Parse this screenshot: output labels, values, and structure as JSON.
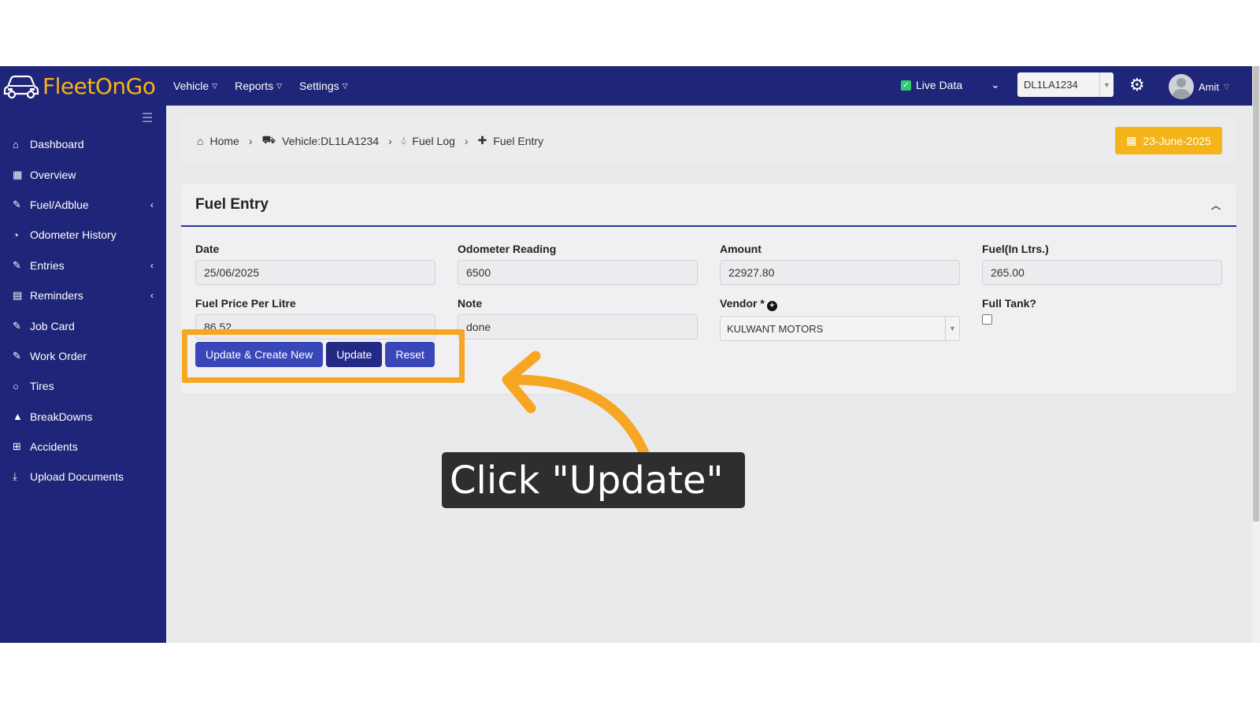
{
  "app": {
    "logo_text": "FleetOnGo",
    "nav": [
      {
        "label": "Vehicle"
      },
      {
        "label": "Reports"
      },
      {
        "label": "Settings"
      }
    ],
    "live_data_label": "Live Data",
    "vehicle_select": "DL1LA1234",
    "user_name": "Amit"
  },
  "sidebar": {
    "items": [
      {
        "label": "Dashboard",
        "icon": "home-icon"
      },
      {
        "label": "Overview",
        "icon": "grid-icon"
      },
      {
        "label": "Fuel/Adblue",
        "icon": "edit-icon",
        "has_children": true
      },
      {
        "label": "Odometer History",
        "icon": "gauge-icon"
      },
      {
        "label": "Entries",
        "icon": "edit-icon",
        "has_children": true
      },
      {
        "label": "Reminders",
        "icon": "calendar-icon",
        "has_children": true
      },
      {
        "label": "Job Card",
        "icon": "edit-icon"
      },
      {
        "label": "Work Order",
        "icon": "edit-icon"
      },
      {
        "label": "Tires",
        "icon": "circle-icon"
      },
      {
        "label": "BreakDowns",
        "icon": "warning-icon"
      },
      {
        "label": "Accidents",
        "icon": "plus-square-icon"
      },
      {
        "label": "Upload Documents",
        "icon": "download-icon"
      }
    ]
  },
  "breadcrumb": {
    "home": "Home",
    "vehicle": "Vehicle:DL1LA1234",
    "fuel_log": "Fuel Log",
    "current": "Fuel Entry"
  },
  "date_button": "23-June-2025",
  "form": {
    "title": "Fuel Entry",
    "date_label": "Date",
    "date_value": "25/06/2025",
    "odometer_label": "Odometer Reading",
    "odometer_value": "6500",
    "amount_label": "Amount",
    "amount_value": "22927.80",
    "fuel_label": "Fuel(In Ltrs.)",
    "fuel_value": "265.00",
    "price_label": "Fuel Price Per Litre",
    "price_value": "86.52",
    "note_label": "Note",
    "note_value": "done",
    "vendor_label": "Vendor *",
    "vendor_value": "KULWANT MOTORS",
    "full_tank_label": "Full Tank?",
    "full_tank_checked": false
  },
  "buttons": {
    "update_create": "Update & Create New",
    "update": "Update",
    "reset": "Reset"
  },
  "annotation": {
    "callout_text": "Click \"Update\"",
    "highlight_color": "#f6a623"
  },
  "colors": {
    "navy": "#1f2578",
    "accent": "#f4b41a",
    "button_blue": "#3a47b8"
  }
}
